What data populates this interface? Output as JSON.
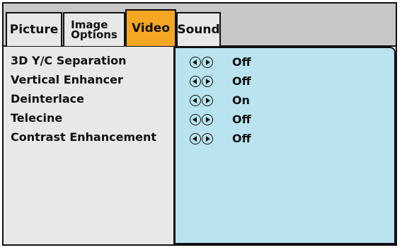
{
  "tabs": [
    {
      "label": "Picture"
    },
    {
      "label_line1": "Image",
      "label_line2": "Options"
    },
    {
      "label": "Video",
      "active": true
    },
    {
      "label": "Sound"
    }
  ],
  "settings": [
    {
      "label": "3D Y/C Separation",
      "value": "Off"
    },
    {
      "label": "Vertical Enhancer",
      "value": "Off"
    },
    {
      "label": "Deinterlace",
      "value": "On"
    },
    {
      "label": "Telecine",
      "value": "Off"
    },
    {
      "label": "Contrast Enhancement",
      "value": "Off"
    }
  ],
  "colors": {
    "active_tab": "#f5a623",
    "panel": "#b9e4ef",
    "tabbar": "#c7c7c7",
    "background": "#e8e8e8"
  }
}
